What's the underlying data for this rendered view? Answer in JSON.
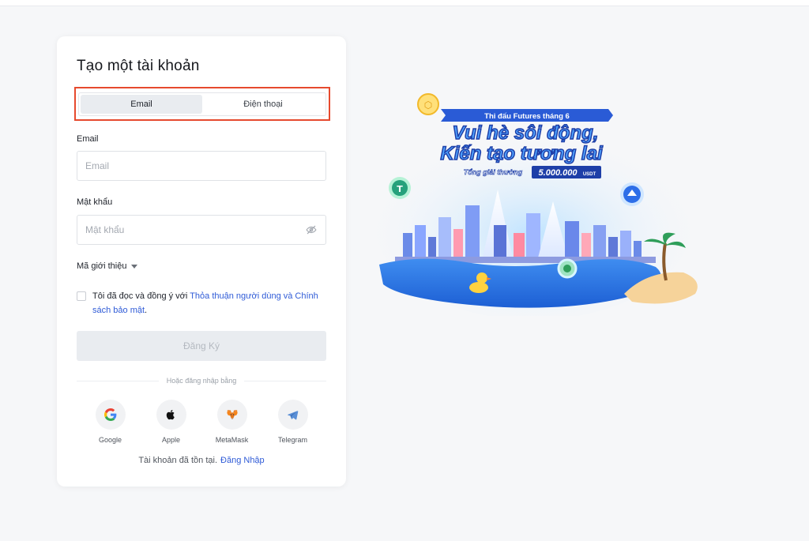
{
  "form": {
    "title": "Tạo một tài khoản",
    "tabs": [
      {
        "label": "Email",
        "active": true
      },
      {
        "label": "Điện thoại",
        "active": false
      }
    ],
    "email_label": "Email",
    "email_placeholder": "Email",
    "email_value": "",
    "password_label": "Mật khẩu",
    "password_placeholder": "Mật khẩu",
    "password_value": "",
    "referral_label": "Mã giới thiệu",
    "agreement": {
      "prefix": "Tôi đã đọc và đồng ý với ",
      "link": "Thỏa thuận người dùng và Chính sách bảo mật",
      "suffix": "."
    },
    "submit_label": "Đăng Ký",
    "divider_text": "Hoặc đăng nhập bằng",
    "socials": [
      {
        "name": "Google",
        "icon": "google-icon"
      },
      {
        "name": "Apple",
        "icon": "apple-icon"
      },
      {
        "name": "MetaMask",
        "icon": "metamask-icon"
      },
      {
        "name": "Telegram",
        "icon": "telegram-icon"
      }
    ],
    "login_prompt": "Tài khoản đã tồn tại.",
    "login_link": "Đăng Nhập"
  },
  "promo": {
    "ribbon": "Thi đấu Futures tháng 6",
    "headline_1": "Vui hè sôi động,",
    "headline_2": "Kiến tạo tương lai",
    "prize_label": "Tổng giải thưởng",
    "prize_value": "5.000.000",
    "prize_unit": "USDT"
  },
  "colors": {
    "accent_link": "#2f5bd7",
    "highlight_border": "#e64a2e",
    "page_bg": "#f6f7f9"
  }
}
